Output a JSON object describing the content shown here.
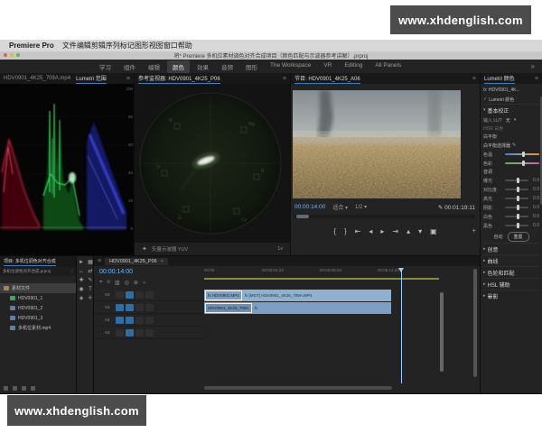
{
  "watermark": {
    "url_text": "www.xhdenglish.com"
  },
  "menu_bar": {
    "app_name": "Premiere Pro",
    "menus": [
      "文件",
      "编辑",
      "剪辑",
      "序列",
      "标记",
      "图形",
      "视图",
      "窗口",
      "帮助"
    ]
  },
  "title_bar": {
    "title": "将* Premiere 多机位素材调色对齐合成项目（颜色匹配与示波器参考讲解）.prproj"
  },
  "workspace_bar": {
    "tabs": [
      {
        "label": "学习"
      },
      {
        "label": "组件"
      },
      {
        "label": "编辑"
      },
      {
        "label": "颜色",
        "active": true
      },
      {
        "label": "效果"
      },
      {
        "label": "音频"
      },
      {
        "label": "图形"
      },
      {
        "label": "The Workspace"
      },
      {
        "label": "VR"
      },
      {
        "label": "Editing"
      },
      {
        "label": "All Panels"
      }
    ],
    "overflow": "»"
  },
  "scopes_panel": {
    "tabs": [
      {
        "label": "HDV0901_4K25_709A.mp4"
      },
      {
        "label": "Lumetri 范围",
        "active": true
      }
    ],
    "scale": [
      "100",
      "80",
      "60",
      "40",
      "20",
      "0"
    ],
    "colors": {
      "red": "#e8304a",
      "green": "#37e06a",
      "blue": "#4455ff"
    }
  },
  "vector_panel": {
    "title": "参考监视器: HDV0901_4K25_P06",
    "footer_left": "矢量示波器 YUV",
    "footer_right": "1x"
  },
  "program_panel": {
    "title": "节目: HDV0901_4K25_A06",
    "timecode": "00:00:14:00",
    "fit_label": "适合",
    "resolution": "1/2",
    "duration": "00:01:19:11",
    "transport": [
      "{",
      "}",
      "⇤",
      "◂",
      "▸",
      "⇥",
      "▴",
      "▾",
      "▣"
    ],
    "add_button": "+"
  },
  "lumetri_panel": {
    "title": "Lumetri 颜色",
    "fx_badge": "fx",
    "clip_name": "HDV0901_4K...",
    "check": "✓",
    "effect_name": "Lumetri 颜色",
    "section_basic": "基本校正",
    "input_lut_label": "输入 LUT",
    "input_lut_value": "无",
    "hdr_label": "HDR 白色",
    "white_balance_label": "白平衡",
    "wb_selector_label": "白平衡选择器",
    "temp_label": "色温",
    "tint_label": "色彩",
    "tone_label": "音调",
    "tone_sliders": [
      {
        "label": "曝光",
        "value": "0.0"
      },
      {
        "label": "对比度",
        "value": "0.0"
      },
      {
        "label": "高光",
        "value": "0.0"
      },
      {
        "label": "阴影",
        "value": "0.0"
      },
      {
        "label": "白色",
        "value": "0.0"
      },
      {
        "label": "黑色",
        "value": "0.0"
      }
    ],
    "auto_label": "自动",
    "reset_label": "重置",
    "sections": [
      "创意",
      "曲线",
      "色轮和匹配",
      "HSL 辅助",
      "晕影"
    ]
  },
  "project_panel": {
    "title": "项目: 多机位调色对齐合成",
    "project_file": "多机位调色对齐合成.prproj",
    "items": [
      {
        "icon": "bin",
        "label": "素材文件",
        "selected": true,
        "indent": 0
      },
      {
        "icon": "sequence",
        "label": "HDV0901_1",
        "indent": 1
      },
      {
        "icon": "clip",
        "label": "HDV0901_2",
        "indent": 1
      },
      {
        "icon": "clip",
        "label": "HDV0901_3",
        "indent": 1
      },
      {
        "icon": "clip",
        "label": "多机位素材.mp4",
        "indent": 1
      }
    ]
  },
  "tools_panel": {
    "tools": [
      "►",
      "▦",
      "↔",
      "⇄",
      "✚",
      "✎",
      "◉",
      "T",
      "◈",
      "✛"
    ]
  },
  "timeline_panel": {
    "tab": "HDV0901_4K25_P06",
    "close": "×",
    "timecode": "00:00:14:00",
    "toolbar_icons": [
      "⌖",
      "≡",
      "▥",
      "◎",
      "⊕",
      "⌁"
    ],
    "ruler_labels": [
      "00:00",
      "00:00:04:23",
      "00:00:09:23",
      "00:00:14:23"
    ],
    "tracks": [
      {
        "name": "V2"
      },
      {
        "name": "V1"
      },
      {
        "name": "A1"
      },
      {
        "name": "A2"
      }
    ],
    "clips": [
      {
        "box_label": "fx HDV0901.MP4",
        "label": "fx [MGT] HDV0901_4K25_709A.MP4"
      },
      {
        "box_label": "HDV0901_4K25_709A",
        "label": "fx"
      }
    ]
  },
  "icons": {
    "panel_menu": "≡",
    "chevron": "▾",
    "search": "○",
    "eyedropper": "✎",
    "settings": "✦",
    "overflow": "»"
  }
}
